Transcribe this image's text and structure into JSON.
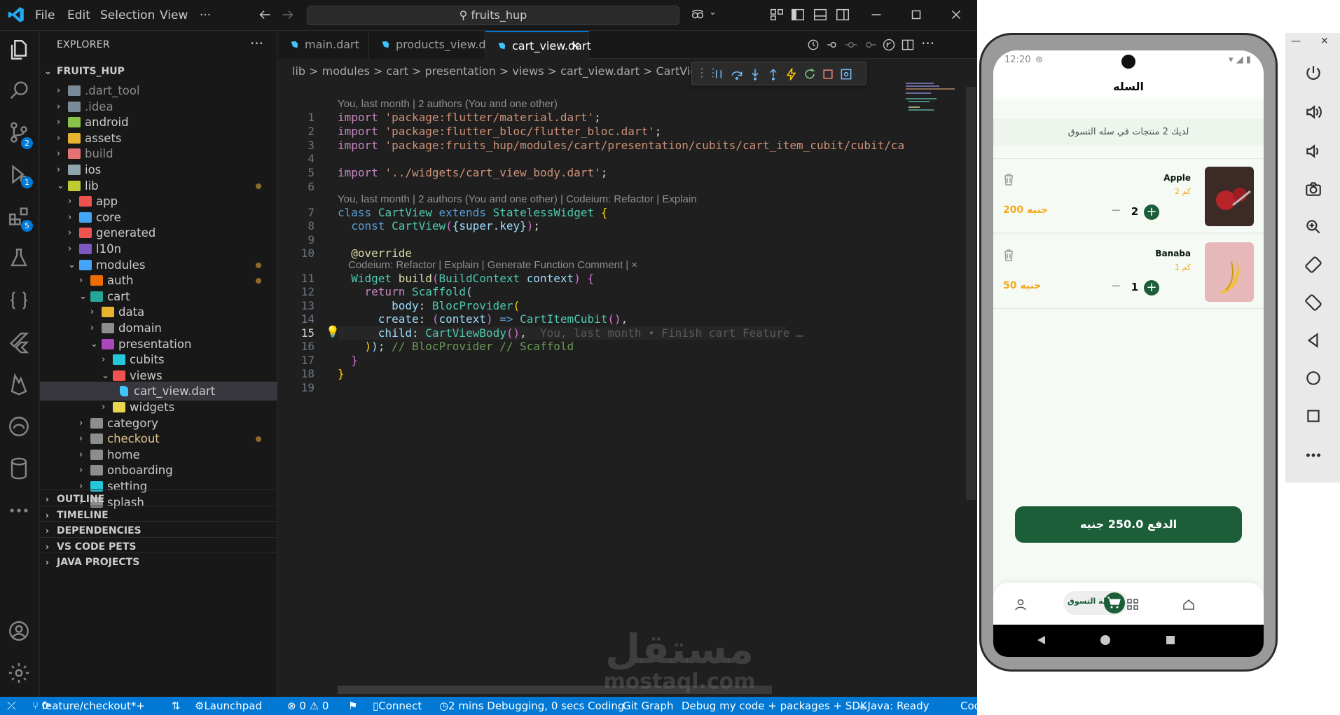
{
  "titlebar": {
    "menus": [
      "File",
      "Edit",
      "Selection",
      "View",
      "···"
    ],
    "search_text": "fruits_hup"
  },
  "activity": {
    "scm_badge": "2",
    "debug_badge": "1",
    "extensions_badge": "5"
  },
  "explorer": {
    "header": "EXPLORER",
    "more": "···",
    "root": "FRUITS_HUP",
    "items": [
      {
        "name": ".dart_tool",
        "depth": 1,
        "open": false,
        "dim": true,
        "color": "#7b8a97"
      },
      {
        "name": ".idea",
        "depth": 1,
        "open": false,
        "dim": true,
        "color": "#7b8a97"
      },
      {
        "name": "android",
        "depth": 1,
        "open": false,
        "dim": false,
        "color": "#8bc34a"
      },
      {
        "name": "assets",
        "depth": 1,
        "open": false,
        "dim": false,
        "color": "#e8b32e"
      },
      {
        "name": "build",
        "depth": 1,
        "open": false,
        "dim": true,
        "color": "#e57373"
      },
      {
        "name": "ios",
        "depth": 1,
        "open": false,
        "dim": false,
        "color": "#90a4ae"
      },
      {
        "name": "lib",
        "depth": 1,
        "open": true,
        "dim": false,
        "color": "#c0ca33",
        "modified": true
      },
      {
        "name": "app",
        "depth": 2,
        "open": false,
        "dim": false,
        "color": "#ef5350"
      },
      {
        "name": "core",
        "depth": 2,
        "open": false,
        "dim": false,
        "color": "#42a5f5"
      },
      {
        "name": "generated",
        "depth": 2,
        "open": false,
        "dim": false,
        "color": "#ef5350"
      },
      {
        "name": "l10n",
        "depth": 2,
        "open": false,
        "dim": false,
        "color": "#7e57c2"
      },
      {
        "name": "modules",
        "depth": 2,
        "open": true,
        "dim": false,
        "color": "#42a5f5",
        "modified": true
      },
      {
        "name": "auth",
        "depth": 3,
        "open": false,
        "dim": false,
        "color": "#ef6c00",
        "modified": true
      },
      {
        "name": "cart",
        "depth": 3,
        "open": true,
        "dim": false,
        "color": "#26a69a"
      },
      {
        "name": "data",
        "depth": 4,
        "open": false,
        "dim": false,
        "color": "#e8b32e"
      },
      {
        "name": "domain",
        "depth": 4,
        "open": false,
        "dim": false,
        "color": "#8d8d8d"
      },
      {
        "name": "presentation",
        "depth": 4,
        "open": true,
        "dim": false,
        "color": "#ab47bc"
      },
      {
        "name": "cubits",
        "depth": 5,
        "open": false,
        "dim": false,
        "color": "#26c6da"
      },
      {
        "name": "views",
        "depth": 5,
        "open": true,
        "dim": false,
        "color": "#ef5350"
      },
      {
        "name": "cart_view.dart",
        "depth": 6,
        "file": true,
        "selected": true,
        "color": "#40c4ff"
      },
      {
        "name": "widgets",
        "depth": 5,
        "open": false,
        "dim": false,
        "color": "#e8d44d"
      },
      {
        "name": "category",
        "depth": 3,
        "open": false,
        "dim": false,
        "color": "#8d8d8d"
      },
      {
        "name": "checkout",
        "depth": 3,
        "open": false,
        "dim": false,
        "color": "#8d8d8d",
        "modified": true,
        "warn": true
      },
      {
        "name": "home",
        "depth": 3,
        "open": false,
        "dim": false,
        "color": "#8d8d8d"
      },
      {
        "name": "onboarding",
        "depth": 3,
        "open": false,
        "dim": false,
        "color": "#8d8d8d"
      },
      {
        "name": "setting",
        "depth": 3,
        "open": false,
        "dim": false,
        "color": "#26c6da"
      },
      {
        "name": "splash",
        "depth": 3,
        "open": false,
        "dim": false,
        "color": "#8d8d8d"
      }
    ],
    "panes": [
      "OUTLINE",
      "TIMELINE",
      "DEPENDENCIES",
      "VS CODE PETS",
      "JAVA PROJECTS"
    ]
  },
  "tabs": [
    {
      "label": "main.dart",
      "active": false
    },
    {
      "label": "products_view.dart",
      "active": false
    },
    {
      "label": "cart_view.dart",
      "active": true
    }
  ],
  "breadcrumb": "lib > modules > cart > presentation > views > cart_view.dart > CartView",
  "code": {
    "lens_top": "You, last month | 2 authors (You and one other)",
    "lens_class": "You, last month | 2 authors (You and one other) | Codeium: Refactor | Explain",
    "lens_build": "Codeium: Refactor | Explain | Generate Function Comment | ×",
    "ghost": "You, last month • Finish cart Feature …",
    "line_numbers": [
      "1",
      "2",
      "3",
      "4",
      "5",
      "6",
      "7",
      "8",
      "9",
      "10",
      "11",
      "12",
      "13",
      "14",
      "15",
      "16",
      "17",
      "18",
      "19"
    ],
    "current_line": "15"
  },
  "statusbar": {
    "branch": "feature/checkout*+",
    "errors": "⊗ 0 ⚠ 0",
    "launchpad": "Launchpad",
    "connect": "Connect",
    "timing": "2 mins Debugging, 0 secs Coding",
    "git_graph": "Git Graph",
    "debug_mode": "Debug my code + packages + SDK",
    "java": "Java: Ready",
    "codeium": "Cod"
  },
  "phone": {
    "time": "12:20",
    "title": "السله",
    "banner": "لديك 2 منتجات في سله التسوق",
    "items": [
      {
        "name": "Apple",
        "weight": "2 كم",
        "price": "200 جنيه",
        "qty": "2"
      },
      {
        "name": "Banaba",
        "weight": "1 كم",
        "price": "50 جنيه",
        "qty": "1"
      }
    ],
    "pay_button": "الدفع  250.0 جنيه",
    "nav_cart_label": "سلة التسوق"
  },
  "watermark": {
    "arabic": "مستقل",
    "latin": "mostaql.com"
  },
  "colors": {
    "accent": "#0078d4",
    "brand_green": "#1b5e37",
    "price_orange": "#f4a91f"
  }
}
